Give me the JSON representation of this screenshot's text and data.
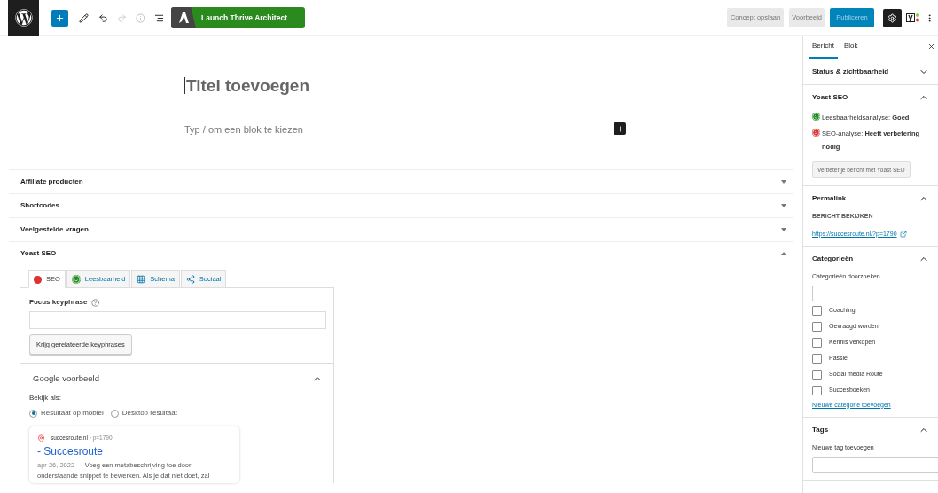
{
  "toolbar": {
    "launch_label": "Launch Thrive Architect",
    "save_draft": "Concept opslaan",
    "preview": "Voorbeeld",
    "publish": "Publiceren",
    "redo_disabled": true
  },
  "editor": {
    "title_placeholder": "Titel toevoegen",
    "block_placeholder": "Typ / om een blok te kiezen"
  },
  "meta_boxes": [
    {
      "title": "Affiliate producten",
      "expanded": false
    },
    {
      "title": "Shortcodes",
      "expanded": false
    },
    {
      "title": "Veelgestelde vragen",
      "expanded": false
    },
    {
      "title": "Yoast SEO",
      "expanded": true
    }
  ],
  "yoast": {
    "tabs": [
      {
        "label": "SEO",
        "kind": "dot",
        "color": "#dc3232",
        "selected": true
      },
      {
        "label": "Leesbaarheid",
        "kind": "smiley",
        "color": "#1e8b1e",
        "selected": false
      },
      {
        "label": "Schema",
        "kind": "grid",
        "selected": false
      },
      {
        "label": "Sociaal",
        "kind": "share",
        "selected": false
      }
    ],
    "focus_label": "Focus keyphrase",
    "related_button": "Krijg gerelateerde keyphrases",
    "preview_title": "Google voorbeeld",
    "preview_expanded": true,
    "view_as": "Bekijk als:",
    "modes": [
      {
        "label": "Resultaat op mobiel",
        "selected": true
      },
      {
        "label": "Desktop resultaat",
        "selected": false
      }
    ],
    "snippet": {
      "site": "succesroute.nl",
      "path": "› p=1790",
      "title": "- Succesroute",
      "date": "apr 26, 2022",
      "description": "— Voeg een metabeschrijving toe door onderstaande snippet te bewerken. Als je dat niet doet, zal"
    }
  },
  "sidebar": {
    "tabs": [
      {
        "label": "Bericht",
        "selected": true
      },
      {
        "label": "Blok",
        "selected": false
      }
    ],
    "status": {
      "title": "Status & zichtbaarheid",
      "expanded": false
    },
    "yoast": {
      "title": "Yoast SEO",
      "expanded": true,
      "analyses": [
        {
          "label": "Leesbaarheidsanalyse:",
          "verdict": "Goed",
          "kind": "good",
          "color": "#1e8b1e"
        },
        {
          "label": "SEO-analyse:",
          "verdict": "Heeft verbetering nodig",
          "kind": "bad",
          "color": "#dc3232"
        }
      ],
      "button": "Verbeter je bericht met Yoast SEO"
    },
    "permalink": {
      "title": "Permalink",
      "expanded": true,
      "heading": "BERICHT BEKIJKEN",
      "url": "https://succesroute.nl/?p=1790"
    },
    "categories": {
      "title": "Categorieën",
      "expanded": true,
      "search_label": "Categorieën doorzoeken",
      "items": [
        {
          "label": "Coaching",
          "checked": false
        },
        {
          "label": "Gevraagd worden",
          "checked": false
        },
        {
          "label": "Kennis verkopen",
          "checked": false
        },
        {
          "label": "Passie",
          "checked": false
        },
        {
          "label": "Social media Route",
          "checked": false
        },
        {
          "label": "Succesboeken",
          "checked": false
        }
      ],
      "add_link": "Nieuwe categorie toevoegen"
    },
    "tags": {
      "title": "Tags",
      "expanded": true,
      "label": "Nieuwe tag toevoegen"
    }
  }
}
